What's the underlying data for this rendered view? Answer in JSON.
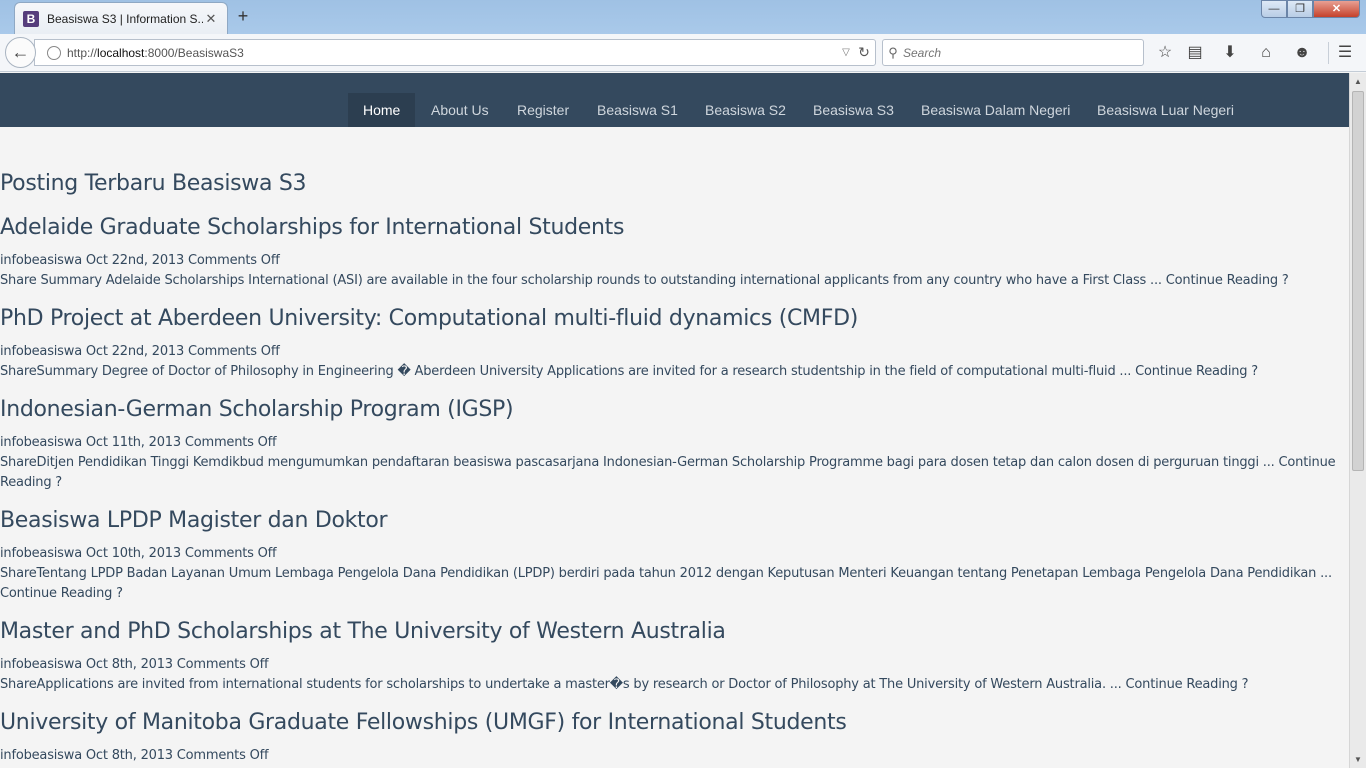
{
  "browser": {
    "tab_title": "Beasiswa S3 | Information S...",
    "tab_favicon": "B",
    "tab_close": "✕",
    "new_tab": "+",
    "url_prefix": "http://",
    "url_host": "localhost",
    "url_path": ":8000/BeasiswaS3",
    "search_placeholder": "Search",
    "icons": [
      "back-arrow-icon",
      "globe-icon",
      "dropdown-icon",
      "reload-icon",
      "search-icon",
      "bookmark-star-icon",
      "reading-list-icon",
      "download-icon",
      "home-icon",
      "smiley-icon",
      "menu-icon"
    ]
  },
  "nav": {
    "items": [
      {
        "label": "Home",
        "active": true
      },
      {
        "label": "About Us"
      },
      {
        "label": "Register"
      },
      {
        "label": "Beasiswa S1"
      },
      {
        "label": "Beasiswa S2"
      },
      {
        "label": "Beasiswa S3"
      },
      {
        "label": "Beasiswa Dalam Negeri"
      },
      {
        "label": "Beasiswa Luar Negeri"
      }
    ]
  },
  "main": {
    "heading": "Posting Terbaru Beasiswa S3",
    "posts": [
      {
        "title": "Adelaide Graduate Scholarships for International Students",
        "meta": "infobeasiswa Oct 22nd, 2013 Comments Off",
        "excerpt": "Share Summary Adelaide Scholarships International (ASI) are available in the four scholarship rounds to outstanding international applicants from any country who have a First Class ... ",
        "read_more": "Continue Reading ?"
      },
      {
        "title": "PhD Project at Aberdeen University: Computational multi-fluid dynamics (CMFD)",
        "meta": "infobeasiswa Oct 22nd, 2013 Comments Off",
        "excerpt": "ShareSummary Degree of Doctor of Philosophy in Engineering � Aberdeen University Applications are invited for a research studentship in the field of computational multi-fluid ... ",
        "read_more": "Continue Reading ?"
      },
      {
        "title": "Indonesian-German Scholarship Program (IGSP)",
        "meta": "infobeasiswa Oct 11th, 2013 Comments Off",
        "excerpt": "ShareDitjen Pendidikan Tinggi Kemdikbud mengumumkan pendaftaran beasiswa pascasarjana Indonesian-German Scholarship Programme bagi para dosen tetap dan calon dosen di perguruan tinggi ... ",
        "read_more": "Continue Reading ?"
      },
      {
        "title": "Beasiswa LPDP Magister dan Doktor",
        "meta": "infobeasiswa Oct 10th, 2013 Comments Off",
        "excerpt": "ShareTentang LPDP Badan Layanan Umum Lembaga Pengelola Dana Pendidikan (LPDP) berdiri pada tahun 2012 dengan Keputusan Menteri Keuangan tentang Penetapan Lembaga Pengelola Dana Pendidikan ... ",
        "read_more": "Continue Reading ?"
      },
      {
        "title": "Master and PhD Scholarships at The University of Western Australia",
        "meta": "infobeasiswa Oct 8th, 2013 Comments Off",
        "excerpt": "ShareApplications are invited from international students for scholarships to undertake a master�s by research or Doctor of Philosophy at The University of Western Australia. ... ",
        "read_more": "Continue Reading ?"
      },
      {
        "title": "University of Manitoba Graduate Fellowships (UMGF) for International Students",
        "meta": "infobeasiswa Oct 8th, 2013 Comments Off",
        "excerpt": "",
        "read_more": ""
      }
    ]
  }
}
